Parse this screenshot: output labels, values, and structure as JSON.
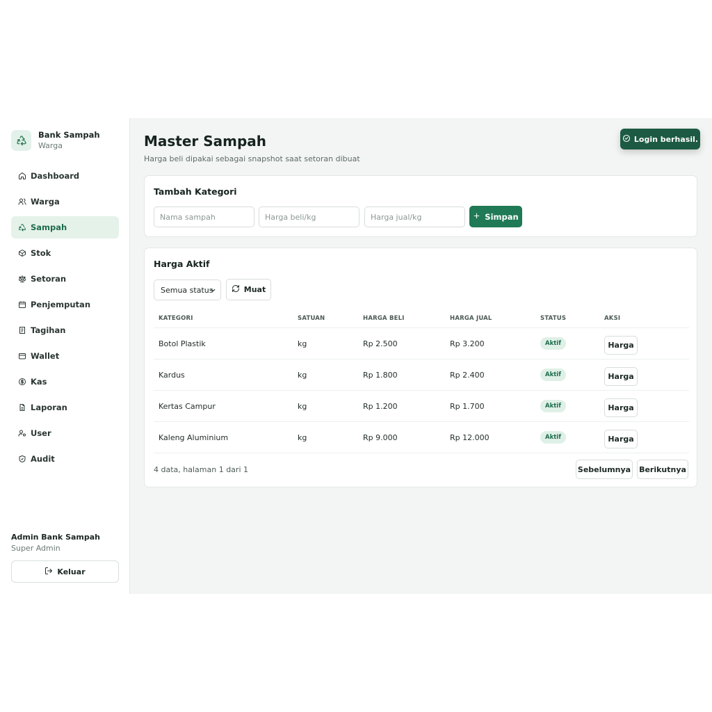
{
  "brand": {
    "title": "Bank Sampah",
    "subtitle": "Warga",
    "icon": "recycle-icon"
  },
  "sidebar": {
    "items": [
      {
        "label": "Dashboard",
        "icon": "home-icon",
        "active": false
      },
      {
        "label": "Warga",
        "icon": "users-icon",
        "active": false
      },
      {
        "label": "Sampah",
        "icon": "recycle-icon",
        "active": true
      },
      {
        "label": "Stok",
        "icon": "box-icon",
        "active": false
      },
      {
        "label": "Setoran",
        "icon": "scale-icon",
        "active": false
      },
      {
        "label": "Penjemputan",
        "icon": "calendar-icon",
        "active": false
      },
      {
        "label": "Tagihan",
        "icon": "receipt-icon",
        "active": false
      },
      {
        "label": "Wallet",
        "icon": "wallet-icon",
        "active": false
      },
      {
        "label": "Kas",
        "icon": "dollar-circle-icon",
        "active": false
      },
      {
        "label": "Laporan",
        "icon": "file-text-icon",
        "active": false
      },
      {
        "label": "User",
        "icon": "user-cog-icon",
        "active": false
      },
      {
        "label": "Audit",
        "icon": "shield-check-icon",
        "active": false
      }
    ]
  },
  "user": {
    "name": "Admin Bank Sampah",
    "role": "Super Admin",
    "logout_label": "Keluar"
  },
  "header": {
    "title": "Master Sampah",
    "subtitle": "Harga beli dipakai sebagai snapshot saat setoran dibuat"
  },
  "toast": {
    "text": "Login berhasil."
  },
  "add_form": {
    "title": "Tambah Kategori",
    "name_placeholder": "Nama sampah",
    "buy_placeholder": "Harga beli/kg",
    "sell_placeholder": "Harga jual/kg",
    "save_label": "Simpan"
  },
  "price_list": {
    "title": "Harga Aktif",
    "status_filter": "Semua status",
    "load_label": "Muat",
    "columns": [
      "KATEGORI",
      "SATUAN",
      "HARGA BELI",
      "HARGA JUAL",
      "STATUS",
      "AKSI"
    ],
    "rows": [
      {
        "category": "Botol Plastik",
        "unit": "kg",
        "buy": "Rp 2.500",
        "sell": "Rp 3.200",
        "status": "Aktif",
        "action": "Harga"
      },
      {
        "category": "Kardus",
        "unit": "kg",
        "buy": "Rp 1.800",
        "sell": "Rp 2.400",
        "status": "Aktif",
        "action": "Harga"
      },
      {
        "category": "Kertas Campur",
        "unit": "kg",
        "buy": "Rp 1.200",
        "sell": "Rp 1.700",
        "status": "Aktif",
        "action": "Harga"
      },
      {
        "category": "Kaleng Aluminium",
        "unit": "kg",
        "buy": "Rp 9.000",
        "sell": "Rp 12.000",
        "status": "Aktif",
        "action": "Harga"
      }
    ],
    "pager_info": "4 data, halaman 1 dari 1",
    "prev_label": "Sebelumnya",
    "next_label": "Berikutnya"
  },
  "colors": {
    "primary": "#1f7a55",
    "toast_bg": "#1d5a44",
    "active_bg": "#e5f2ea",
    "badge_bg": "#dff0e6"
  }
}
